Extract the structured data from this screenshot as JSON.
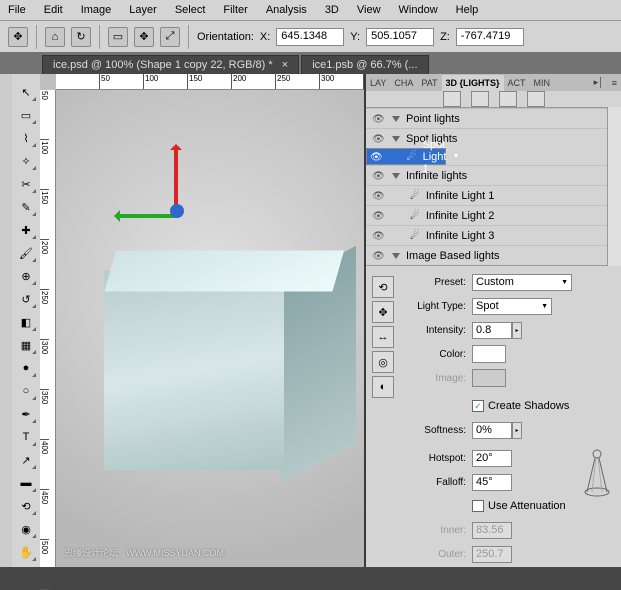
{
  "menu": [
    "File",
    "Edit",
    "Image",
    "Layer",
    "Select",
    "Filter",
    "Analysis",
    "3D",
    "View",
    "Window",
    "Help"
  ],
  "optionsbar": {
    "orientation_label": "Orientation:",
    "x_label": "X:",
    "x_val": "645.1348",
    "y_label": "Y:",
    "y_val": "505.1057",
    "z_label": "Z:",
    "z_val": "-767.4719"
  },
  "doc_tabs": [
    "ice.psd @ 100% (Shape 1 copy 22, RGB/8) *",
    "ice1.psb @ 66.7% (..."
  ],
  "ruler_h": [
    "",
    "50",
    "100",
    "150",
    "200",
    "250",
    "300"
  ],
  "ruler_v": [
    "50",
    "100",
    "150",
    "200",
    "250",
    "300",
    "350",
    "400",
    "450",
    "500"
  ],
  "panel_tabs": [
    "LAY",
    "CHA",
    "PAT",
    "3D {LIGHTS}",
    "ACT",
    "MIN"
  ],
  "lights": {
    "point_header": "Point lights",
    "spot_header": "Spot lights",
    "spot1": "Spot Light 1",
    "infinite_header": "Infinite lights",
    "inf1": "Infinite Light 1",
    "inf2": "Infinite Light 2",
    "inf3": "Infinite Light 3",
    "image_header": "Image Based lights"
  },
  "props": {
    "preset_label": "Preset:",
    "preset_val": "Custom",
    "type_label": "Light Type:",
    "type_val": "Spot",
    "intensity_label": "Intensity:",
    "intensity_val": "0.8",
    "color_label": "Color:",
    "image_label": "Image:",
    "shadows_label": "Create Shadows",
    "softness_label": "Softness:",
    "softness_val": "0%",
    "hotspot_label": "Hotspot:",
    "hotspot_val": "20°",
    "falloff_label": "Falloff:",
    "falloff_val": "45°",
    "atten_label": "Use Attenuation",
    "inner_label": "Inner:",
    "inner_val": "83.56",
    "outer_label": "Outer:",
    "outer_val": "250.7"
  },
  "watermark": "思缘设计论坛 · WWW.MISSYUAN.COM"
}
